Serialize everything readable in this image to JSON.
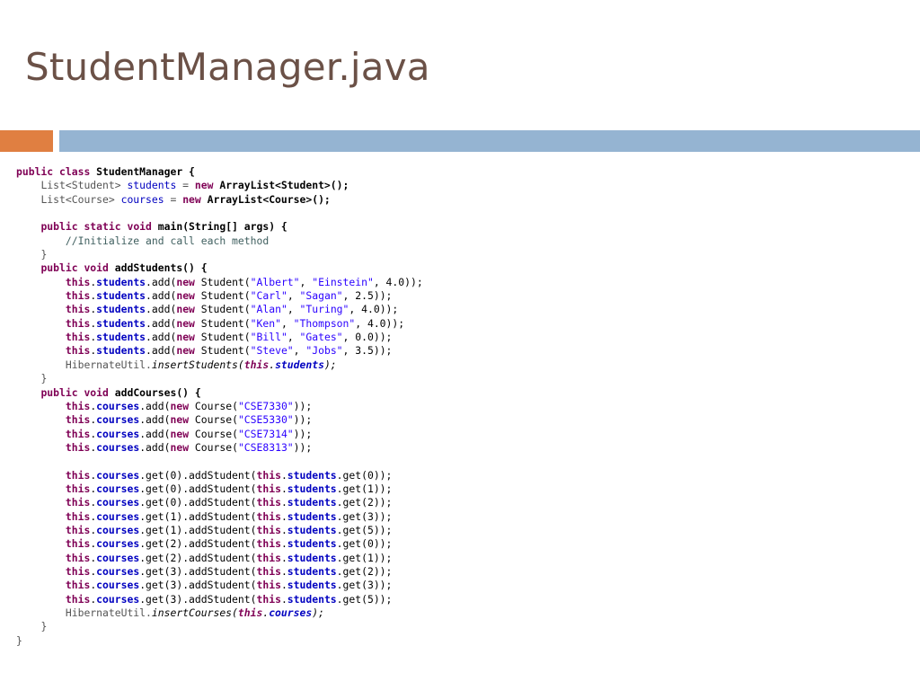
{
  "slide": {
    "title": "StudentManager.java"
  },
  "code": {
    "lines": [
      [
        [
          "public",
          "kw"
        ],
        [
          " ",
          "plain"
        ],
        [
          "class",
          "kw"
        ],
        [
          " StudentManager {",
          "bold"
        ]
      ],
      [
        [
          "    ",
          "plain"
        ],
        [
          "List<Student> ",
          "gray"
        ],
        [
          "students",
          "field"
        ],
        [
          " = ",
          "gray"
        ],
        [
          "new",
          "kw"
        ],
        [
          " ArrayList<Student>();",
          "bold"
        ]
      ],
      [
        [
          "    ",
          "plain"
        ],
        [
          "List<Course> ",
          "gray"
        ],
        [
          "courses",
          "field"
        ],
        [
          " = ",
          "gray"
        ],
        [
          "new",
          "kw"
        ],
        [
          " ArrayList<Course>();",
          "bold"
        ]
      ],
      [],
      [
        [
          "    ",
          "plain"
        ],
        [
          "public",
          "kw"
        ],
        [
          " ",
          "plain"
        ],
        [
          "static",
          "kw"
        ],
        [
          " ",
          "plain"
        ],
        [
          "void",
          "kw"
        ],
        [
          " main(String[] args) {",
          "bold"
        ]
      ],
      [
        [
          "        ",
          "plain"
        ],
        [
          "//Initialize and call each method",
          "comment"
        ]
      ],
      [
        [
          "    ",
          "plain"
        ],
        [
          "}",
          "gray"
        ]
      ],
      [
        [
          "    ",
          "plain"
        ],
        [
          "public",
          "kw"
        ],
        [
          " ",
          "plain"
        ],
        [
          "void",
          "kw"
        ],
        [
          " addStudents() {",
          "bold"
        ]
      ],
      [
        [
          "        ",
          "plain"
        ],
        [
          "this",
          "kw"
        ],
        [
          ".",
          "plain"
        ],
        [
          "students",
          "fieldb"
        ],
        [
          ".add(",
          "plain"
        ],
        [
          "new",
          "kw"
        ],
        [
          " Student(",
          "plain"
        ],
        [
          "\"Albert\"",
          "str"
        ],
        [
          ", ",
          "plain"
        ],
        [
          "\"Einstein\"",
          "str"
        ],
        [
          ", 4.0));",
          "plain"
        ]
      ],
      [
        [
          "        ",
          "plain"
        ],
        [
          "this",
          "kw"
        ],
        [
          ".",
          "plain"
        ],
        [
          "students",
          "fieldb"
        ],
        [
          ".add(",
          "plain"
        ],
        [
          "new",
          "kw"
        ],
        [
          " Student(",
          "plain"
        ],
        [
          "\"Carl\"",
          "str"
        ],
        [
          ", ",
          "plain"
        ],
        [
          "\"Sagan\"",
          "str"
        ],
        [
          ", 2.5));",
          "plain"
        ]
      ],
      [
        [
          "        ",
          "plain"
        ],
        [
          "this",
          "kw"
        ],
        [
          ".",
          "plain"
        ],
        [
          "students",
          "fieldb"
        ],
        [
          ".add(",
          "plain"
        ],
        [
          "new",
          "kw"
        ],
        [
          " Student(",
          "plain"
        ],
        [
          "\"Alan\"",
          "str"
        ],
        [
          ", ",
          "plain"
        ],
        [
          "\"Turing\"",
          "str"
        ],
        [
          ", 4.0));",
          "plain"
        ]
      ],
      [
        [
          "        ",
          "plain"
        ],
        [
          "this",
          "kw"
        ],
        [
          ".",
          "plain"
        ],
        [
          "students",
          "fieldb"
        ],
        [
          ".add(",
          "plain"
        ],
        [
          "new",
          "kw"
        ],
        [
          " Student(",
          "plain"
        ],
        [
          "\"Ken\"",
          "str"
        ],
        [
          ", ",
          "plain"
        ],
        [
          "\"Thompson\"",
          "str"
        ],
        [
          ", 4.0));",
          "plain"
        ]
      ],
      [
        [
          "        ",
          "plain"
        ],
        [
          "this",
          "kw"
        ],
        [
          ".",
          "plain"
        ],
        [
          "students",
          "fieldb"
        ],
        [
          ".add(",
          "plain"
        ],
        [
          "new",
          "kw"
        ],
        [
          " Student(",
          "plain"
        ],
        [
          "\"Bill\"",
          "str"
        ],
        [
          ", ",
          "plain"
        ],
        [
          "\"Gates\"",
          "str"
        ],
        [
          ", 0.0));",
          "plain"
        ]
      ],
      [
        [
          "        ",
          "plain"
        ],
        [
          "this",
          "kw"
        ],
        [
          ".",
          "plain"
        ],
        [
          "students",
          "fieldb"
        ],
        [
          ".add(",
          "plain"
        ],
        [
          "new",
          "kw"
        ],
        [
          " Student(",
          "plain"
        ],
        [
          "\"Steve\"",
          "str"
        ],
        [
          ", ",
          "plain"
        ],
        [
          "\"Jobs\"",
          "str"
        ],
        [
          ", 3.5));",
          "plain"
        ]
      ],
      [
        [
          "        ",
          "plain"
        ],
        [
          "HibernateUtil.",
          "gray"
        ],
        [
          "insertStudents(",
          "italic"
        ],
        [
          "this",
          "kwi"
        ],
        [
          ".",
          "italic"
        ],
        [
          "students",
          "fieldbi"
        ],
        [
          ");",
          "italic"
        ]
      ],
      [
        [
          "    ",
          "plain"
        ],
        [
          "}",
          "gray"
        ]
      ],
      [
        [
          "    ",
          "plain"
        ],
        [
          "public",
          "kw"
        ],
        [
          " ",
          "plain"
        ],
        [
          "void",
          "kw"
        ],
        [
          " addCourses() {",
          "bold"
        ]
      ],
      [
        [
          "        ",
          "plain"
        ],
        [
          "this",
          "kw"
        ],
        [
          ".",
          "plain"
        ],
        [
          "courses",
          "fieldb"
        ],
        [
          ".add(",
          "plain"
        ],
        [
          "new",
          "kw"
        ],
        [
          " Course(",
          "plain"
        ],
        [
          "\"CSE7330\"",
          "str"
        ],
        [
          "));",
          "plain"
        ]
      ],
      [
        [
          "        ",
          "plain"
        ],
        [
          "this",
          "kw"
        ],
        [
          ".",
          "plain"
        ],
        [
          "courses",
          "fieldb"
        ],
        [
          ".add(",
          "plain"
        ],
        [
          "new",
          "kw"
        ],
        [
          " Course(",
          "plain"
        ],
        [
          "\"CSE5330\"",
          "str"
        ],
        [
          "));",
          "plain"
        ]
      ],
      [
        [
          "        ",
          "plain"
        ],
        [
          "this",
          "kw"
        ],
        [
          ".",
          "plain"
        ],
        [
          "courses",
          "fieldb"
        ],
        [
          ".add(",
          "plain"
        ],
        [
          "new",
          "kw"
        ],
        [
          " Course(",
          "plain"
        ],
        [
          "\"CSE7314\"",
          "str"
        ],
        [
          "));",
          "plain"
        ]
      ],
      [
        [
          "        ",
          "plain"
        ],
        [
          "this",
          "kw"
        ],
        [
          ".",
          "plain"
        ],
        [
          "courses",
          "fieldb"
        ],
        [
          ".add(",
          "plain"
        ],
        [
          "new",
          "kw"
        ],
        [
          " Course(",
          "plain"
        ],
        [
          "\"CSE8313\"",
          "str"
        ],
        [
          "));",
          "plain"
        ]
      ],
      [],
      [
        [
          "        ",
          "plain"
        ],
        [
          "this",
          "kw"
        ],
        [
          ".",
          "plain"
        ],
        [
          "courses",
          "fieldb"
        ],
        [
          ".get(0).addStudent(",
          "plain"
        ],
        [
          "this",
          "kw"
        ],
        [
          ".",
          "plain"
        ],
        [
          "students",
          "fieldb"
        ],
        [
          ".get(0));",
          "plain"
        ]
      ],
      [
        [
          "        ",
          "plain"
        ],
        [
          "this",
          "kw"
        ],
        [
          ".",
          "plain"
        ],
        [
          "courses",
          "fieldb"
        ],
        [
          ".get(0).addStudent(",
          "plain"
        ],
        [
          "this",
          "kw"
        ],
        [
          ".",
          "plain"
        ],
        [
          "students",
          "fieldb"
        ],
        [
          ".get(1));",
          "plain"
        ]
      ],
      [
        [
          "        ",
          "plain"
        ],
        [
          "this",
          "kw"
        ],
        [
          ".",
          "plain"
        ],
        [
          "courses",
          "fieldb"
        ],
        [
          ".get(0).addStudent(",
          "plain"
        ],
        [
          "this",
          "kw"
        ],
        [
          ".",
          "plain"
        ],
        [
          "students",
          "fieldb"
        ],
        [
          ".get(2));",
          "plain"
        ]
      ],
      [
        [
          "        ",
          "plain"
        ],
        [
          "this",
          "kw"
        ],
        [
          ".",
          "plain"
        ],
        [
          "courses",
          "fieldb"
        ],
        [
          ".get(1).addStudent(",
          "plain"
        ],
        [
          "this",
          "kw"
        ],
        [
          ".",
          "plain"
        ],
        [
          "students",
          "fieldb"
        ],
        [
          ".get(3));",
          "plain"
        ]
      ],
      [
        [
          "        ",
          "plain"
        ],
        [
          "this",
          "kw"
        ],
        [
          ".",
          "plain"
        ],
        [
          "courses",
          "fieldb"
        ],
        [
          ".get(1).addStudent(",
          "plain"
        ],
        [
          "this",
          "kw"
        ],
        [
          ".",
          "plain"
        ],
        [
          "students",
          "fieldb"
        ],
        [
          ".get(5));",
          "plain"
        ]
      ],
      [
        [
          "        ",
          "plain"
        ],
        [
          "this",
          "kw"
        ],
        [
          ".",
          "plain"
        ],
        [
          "courses",
          "fieldb"
        ],
        [
          ".get(2).addStudent(",
          "plain"
        ],
        [
          "this",
          "kw"
        ],
        [
          ".",
          "plain"
        ],
        [
          "students",
          "fieldb"
        ],
        [
          ".get(0));",
          "plain"
        ]
      ],
      [
        [
          "        ",
          "plain"
        ],
        [
          "this",
          "kw"
        ],
        [
          ".",
          "plain"
        ],
        [
          "courses",
          "fieldb"
        ],
        [
          ".get(2).addStudent(",
          "plain"
        ],
        [
          "this",
          "kw"
        ],
        [
          ".",
          "plain"
        ],
        [
          "students",
          "fieldb"
        ],
        [
          ".get(1));",
          "plain"
        ]
      ],
      [
        [
          "        ",
          "plain"
        ],
        [
          "this",
          "kw"
        ],
        [
          ".",
          "plain"
        ],
        [
          "courses",
          "fieldb"
        ],
        [
          ".get(3).addStudent(",
          "plain"
        ],
        [
          "this",
          "kw"
        ],
        [
          ".",
          "plain"
        ],
        [
          "students",
          "fieldb"
        ],
        [
          ".get(2));",
          "plain"
        ]
      ],
      [
        [
          "        ",
          "plain"
        ],
        [
          "this",
          "kw"
        ],
        [
          ".",
          "plain"
        ],
        [
          "courses",
          "fieldb"
        ],
        [
          ".get(3).addStudent(",
          "plain"
        ],
        [
          "this",
          "kw"
        ],
        [
          ".",
          "plain"
        ],
        [
          "students",
          "fieldb"
        ],
        [
          ".get(3));",
          "plain"
        ]
      ],
      [
        [
          "        ",
          "plain"
        ],
        [
          "this",
          "kw"
        ],
        [
          ".",
          "plain"
        ],
        [
          "courses",
          "fieldb"
        ],
        [
          ".get(3).addStudent(",
          "plain"
        ],
        [
          "this",
          "kw"
        ],
        [
          ".",
          "plain"
        ],
        [
          "students",
          "fieldb"
        ],
        [
          ".get(5));",
          "plain"
        ]
      ],
      [
        [
          "        ",
          "plain"
        ],
        [
          "HibernateUtil.",
          "gray"
        ],
        [
          "insertCourses(",
          "italic"
        ],
        [
          "this",
          "kwi"
        ],
        [
          ".",
          "italic"
        ],
        [
          "courses",
          "fieldbi"
        ],
        [
          ");",
          "italic"
        ]
      ],
      [
        [
          "    ",
          "plain"
        ],
        [
          "}",
          "gray"
        ]
      ],
      [
        [
          "}",
          "gray"
        ]
      ]
    ]
  }
}
